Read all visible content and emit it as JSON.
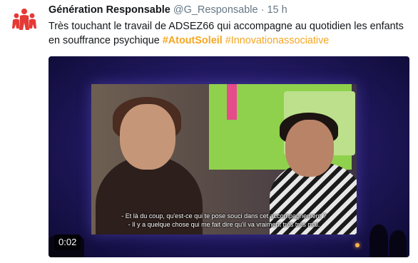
{
  "tweet": {
    "display_name": "Génération Responsable",
    "handle": "@G_Responsable",
    "separator": "·",
    "time": "15 h",
    "text_main": "Très touchant le travail de ADSEZ66 qui accompagne au quotidien les enfants en souffrance psychique ",
    "hashtag_1": "#AtoutSoleil",
    "hashtag_2": "#Innovationassociative"
  },
  "video": {
    "subtitle_line_1": "- Et là du coup, qu'est-ce qui te pose souci dans cet accompagnement ?",
    "subtitle_line_2": "- Il y a quelque chose qui me fait dire qu'il va vraiment très très mal.",
    "time_display": "0:02"
  },
  "colors": {
    "hashtag": "#f5a623",
    "brand": "#e53935",
    "muted": "#657786"
  },
  "icons": {
    "avatar": "generation-responsable-logo"
  }
}
